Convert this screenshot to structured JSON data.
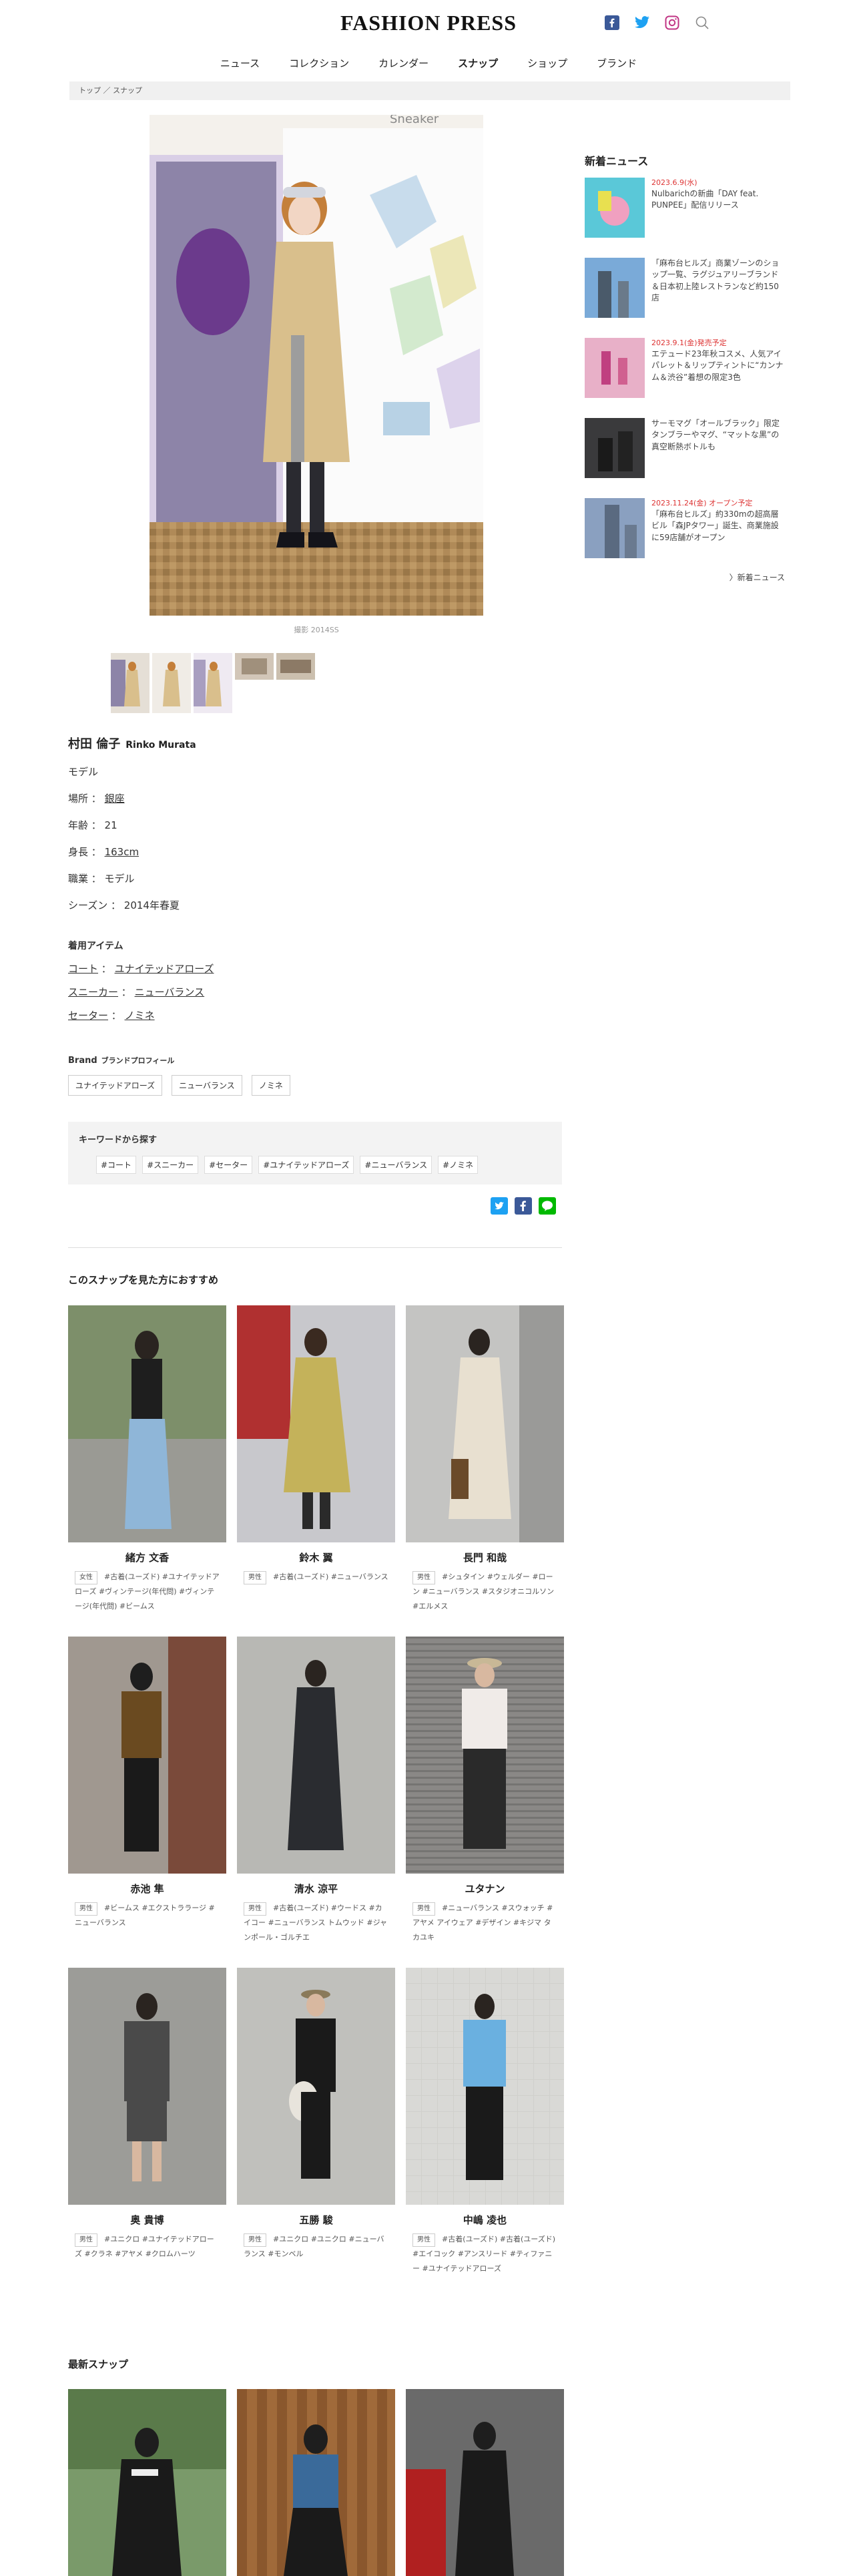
{
  "header": {
    "logo": "FASHION PRESS",
    "icons": [
      "facebook-icon",
      "twitter-icon",
      "instagram-icon",
      "search-icon"
    ]
  },
  "nav": [
    "ニュース",
    "コレクション",
    "カレンダー",
    "スナップ",
    "ショップ",
    "ブランド"
  ],
  "breadcrumb": "トップ ／ スナップ",
  "photo_caption": "撮影 2014SS",
  "profile": {
    "name": "村田 倫子",
    "name_en": "Rinko Murata",
    "job": "モデル",
    "place_label": "場所 ：",
    "place": "銀座",
    "age_label": "年齢 ： 21",
    "height_label": "身長 ：",
    "height": "163cm",
    "occupation_label": "職業 ： モデル",
    "season_label": "シーズン ： 2014年春夏"
  },
  "items": {
    "title": "着用アイテム",
    "list": [
      {
        "item": "コート",
        "brand": "ユナイテッドアローズ"
      },
      {
        "item": "スニーカー",
        "brand": "ニューバランス"
      },
      {
        "item": "セーター",
        "brand": "ノミネ"
      }
    ]
  },
  "brand": {
    "title": "Brand",
    "subtitle": "ブランドプロフィール",
    "tags": [
      "ユナイテッドアローズ",
      "ニューバランス",
      "ノミネ"
    ]
  },
  "keywords": {
    "title": "キーワードから探す",
    "tags": [
      "#コート",
      "#スニーカー",
      "#セーター",
      "#ユナイテッドアローズ",
      "#ニューバランス",
      "#ノミネ"
    ]
  },
  "recommend": {
    "title": "このスナップを見た方におすすめ",
    "cards": [
      {
        "name": "緒方 文香",
        "gender": "女性",
        "tags": "#古着(ユーズド) #ユナイテッドアローズ #ヴィンテージ(年代問) #ヴィンテージ(年代問) #ビームス"
      },
      {
        "name": "鈴木 翼",
        "gender": "男性",
        "tags": "#古着(ユーズド) #ニューバランス"
      },
      {
        "name": "長門 和哉",
        "gender": "男性",
        "tags": "#シュタイン #ウェルダー #ローン #ニューバランス #スタジオニコルソン #エルメス"
      },
      {
        "name": "赤池 隼",
        "gender": "男性",
        "tags": "#ビームス #エクストララージ #ニューバランス"
      },
      {
        "name": "清水 涼平",
        "gender": "男性",
        "tags": "#古着(ユーズド) #ウードス #カイコー #ニューバランス トムウッド #ジャンポール・ゴルチエ"
      },
      {
        "name": "ユタナン",
        "gender": "男性",
        "tags": "#ニューバランス #スウォッチ #アヤメ アイウェア #デザイン #キジマ タカユキ"
      },
      {
        "name": "奥 貴博",
        "gender": "男性",
        "tags": "#ユニクロ #ユナイテッドアローズ #クラネ #アヤメ #クロムハーツ"
      },
      {
        "name": "五勝 駿",
        "gender": "男性",
        "tags": "#ユニクロ #ユニクロ #ニューバランス #モンベル"
      },
      {
        "name": "中嶋 凌也",
        "gender": "男性",
        "tags": "#古着(ユーズド) #古着(ユーズド) #エイコック #アンスリード #ティファニー #ユナイテッドアローズ"
      }
    ]
  },
  "latest": {
    "title": "最新スナップ"
  },
  "sidebar": {
    "title": "新着ニュース",
    "news": [
      {
        "date": "2023.6.9(水)",
        "text": "Nulbarichの新曲「DAY feat. PUNPEE」配信リリース"
      },
      {
        "date": "",
        "text": "「麻布台ヒルズ」商業ゾーンのショップ一覧、ラグジュアリーブランド＆日本初上陸レストランなど約150店"
      },
      {
        "date": "2023.9.1(金)発売予定",
        "text": "エテュード23年秋コスメ、人気アイパレット＆リップティントに“カンナム＆渋谷”着想の限定3色"
      },
      {
        "date": "",
        "text": "サーモマグ「オールブラック」限定タンブラーやマグ、“マットな黒”の真空断熱ボトルも"
      },
      {
        "date": "2023.11.24(金) オープン予定",
        "text": "「麻布台ヒルズ」約330mの超高層ビル「森JPタワー」誕生、商業施設に59店舗がオープン"
      }
    ],
    "more": "〉新着ニュース"
  },
  "colors": {
    "twitter": "#1da1f2",
    "facebook": "#3b5998",
    "line": "#00b900",
    "accent_red": "#d33"
  }
}
